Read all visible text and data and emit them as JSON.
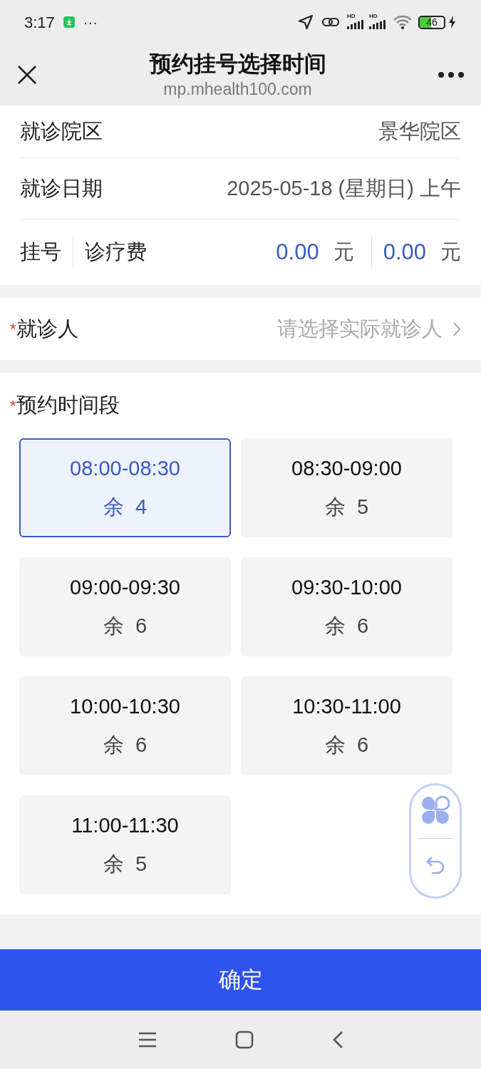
{
  "status_bar": {
    "time": "3:17",
    "overflow": "···",
    "signal_labels": [
      "HD",
      "HD"
    ],
    "battery": "46"
  },
  "nav": {
    "title": "预约挂号选择时间",
    "subtitle": "mp.mhealth100.com"
  },
  "info": {
    "campus_label": "就诊院区",
    "campus": "景华院区",
    "date_label": "就诊日期",
    "date": "2025-05-18 (星期日) 上午",
    "fee_labels": [
      "挂号",
      "诊疗费"
    ],
    "fees": [
      {
        "amount": "0.00",
        "unit": "元"
      },
      {
        "amount": "0.00",
        "unit": "元"
      }
    ]
  },
  "patient": {
    "required": "*",
    "label": "就诊人",
    "placeholder": "请选择实际就诊人"
  },
  "slots_section": {
    "required": "*",
    "title": "预约时间段"
  },
  "slots": [
    {
      "time": "08:00-08:30",
      "remaining": "余  4",
      "selected": true
    },
    {
      "time": "08:30-09:00",
      "remaining": "余  5",
      "selected": false
    },
    {
      "time": "09:00-09:30",
      "remaining": "余  6",
      "selected": false
    },
    {
      "time": "09:30-10:00",
      "remaining": "余  6",
      "selected": false
    },
    {
      "time": "10:00-10:30",
      "remaining": "余  6",
      "selected": false
    },
    {
      "time": "10:30-11:00",
      "remaining": "余  6",
      "selected": false
    },
    {
      "time": "11:00-11:30",
      "remaining": "余  5",
      "selected": false
    }
  ],
  "confirm": "确定"
}
